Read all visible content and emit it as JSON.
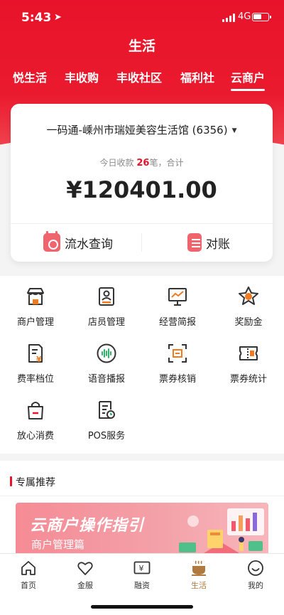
{
  "status_bar": {
    "time": "5:43",
    "network": "4G"
  },
  "page_title": "生活",
  "tabs": [
    {
      "label": "悦生活"
    },
    {
      "label": "丰收购"
    },
    {
      "label": "丰收社区"
    },
    {
      "label": "福利社"
    },
    {
      "label": "云商户",
      "active": true
    }
  ],
  "card": {
    "merchant": "一码通-嵊州市瑞娅美容生活馆 (6356)",
    "today_prefix": "今日收款",
    "today_count": "26",
    "today_suffix": "笔，合计",
    "amount": "¥120401.00",
    "actions": [
      {
        "label": "流水查询",
        "icon": "calendar-icon"
      },
      {
        "label": "对账",
        "icon": "document-icon"
      }
    ]
  },
  "services": [
    {
      "label": "商户管理",
      "icon": "store-icon"
    },
    {
      "label": "店员管理",
      "icon": "staff-badge-icon"
    },
    {
      "label": "经营简报",
      "icon": "presentation-chart-icon"
    },
    {
      "label": "奖励金",
      "icon": "reward-star-icon"
    },
    {
      "label": "费率档位",
      "icon": "rate-document-icon"
    },
    {
      "label": "语音播报",
      "icon": "voice-wave-icon"
    },
    {
      "label": "票券核销",
      "icon": "ticket-scan-icon"
    },
    {
      "label": "票券统计",
      "icon": "ticket-icon"
    },
    {
      "label": "放心消费",
      "icon": "shopping-bag-icon"
    },
    {
      "label": "POS服务",
      "icon": "pos-document-icon"
    }
  ],
  "recommend": {
    "title": "专属推荐",
    "banner_title": "云商户操作指引",
    "banner_subtitle": "商户管理篇"
  },
  "tabbar": [
    {
      "label": "首页",
      "icon": "home-icon"
    },
    {
      "label": "金服",
      "icon": "heart-icon"
    },
    {
      "label": "融资",
      "icon": "yuan-box-icon"
    },
    {
      "label": "生活",
      "icon": "coffee-cup-icon",
      "active": true
    },
    {
      "label": "我的",
      "icon": "smile-face-icon"
    }
  ],
  "colors": {
    "brand_red": "#e8132a",
    "accent_gold": "#b07a3f",
    "icon_orange": "#f07b20"
  }
}
